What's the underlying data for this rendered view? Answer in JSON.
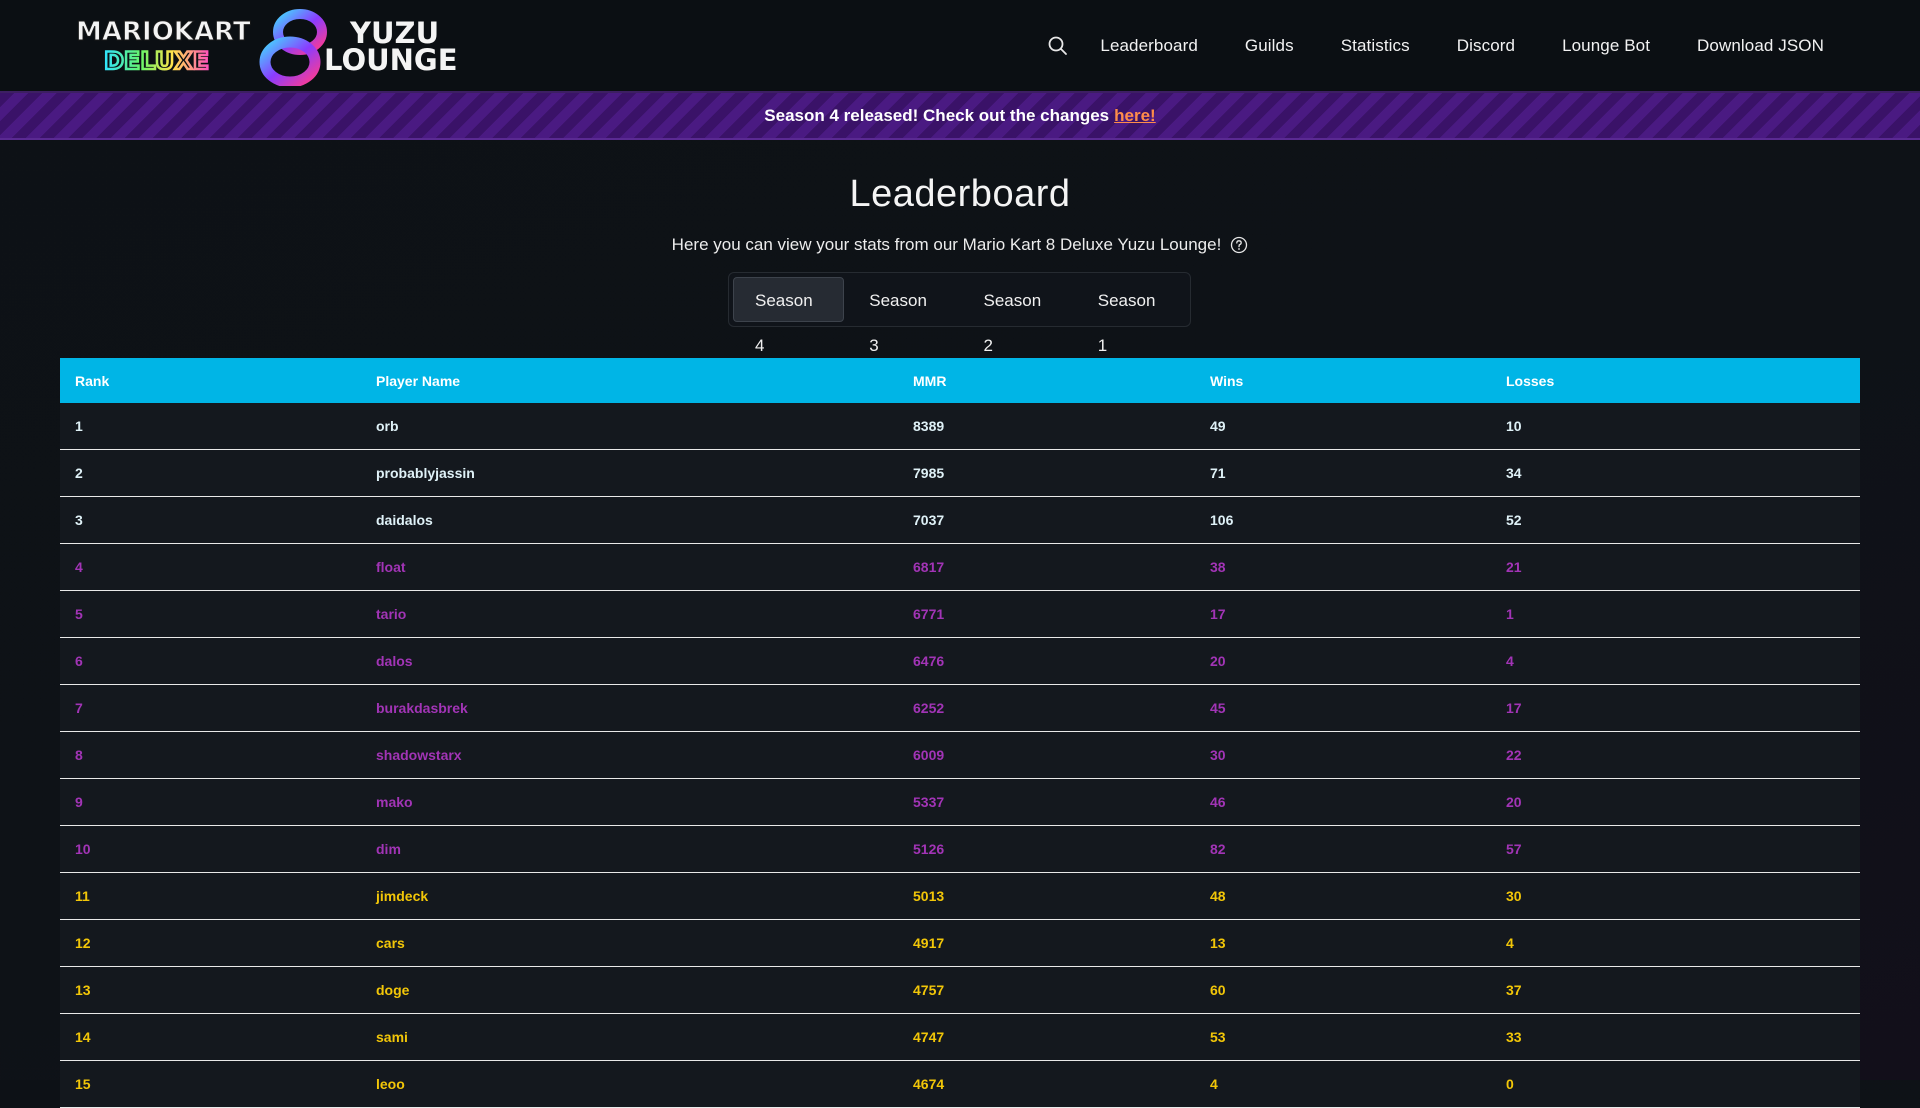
{
  "header": {
    "logo_lines": [
      "MARIOKART",
      "DELUXE",
      "8",
      "YUZU",
      "LOUNGE"
    ],
    "nav": [
      "Leaderboard",
      "Guilds",
      "Statistics",
      "Discord",
      "Lounge Bot",
      "Download JSON"
    ]
  },
  "banner": {
    "text": "Season 4 released! Check out the changes",
    "link": "here!"
  },
  "page": {
    "title": "Leaderboard",
    "subtitle": "Here you can view your stats from our Mario Kart 8 Deluxe Yuzu Lounge!"
  },
  "seasons": {
    "tabs": [
      "Season 4",
      "Season 3",
      "Season 2",
      "Season 1"
    ],
    "selected": "Season 4"
  },
  "table": {
    "columns": [
      "Rank",
      "Player Name",
      "MMR",
      "Wins",
      "Losses"
    ],
    "rows": [
      {
        "rank": "1",
        "name": "orb",
        "mmr": "8389",
        "wins": "49",
        "losses": "10",
        "tier": "diamond"
      },
      {
        "rank": "2",
        "name": "probablyjassin",
        "mmr": "7985",
        "wins": "71",
        "losses": "34",
        "tier": "diamond"
      },
      {
        "rank": "3",
        "name": "daidalos",
        "mmr": "7037",
        "wins": "106",
        "losses": "52",
        "tier": "diamond"
      },
      {
        "rank": "4",
        "name": "float",
        "mmr": "6817",
        "wins": "38",
        "losses": "21",
        "tier": "master"
      },
      {
        "rank": "5",
        "name": "tario",
        "mmr": "6771",
        "wins": "17",
        "losses": "1",
        "tier": "master"
      },
      {
        "rank": "6",
        "name": "dalos",
        "mmr": "6476",
        "wins": "20",
        "losses": "4",
        "tier": "master"
      },
      {
        "rank": "7",
        "name": "burakdasbrek",
        "mmr": "6252",
        "wins": "45",
        "losses": "17",
        "tier": "master"
      },
      {
        "rank": "8",
        "name": "shadowstarx",
        "mmr": "6009",
        "wins": "30",
        "losses": "22",
        "tier": "master"
      },
      {
        "rank": "9",
        "name": "mako",
        "mmr": "5337",
        "wins": "46",
        "losses": "20",
        "tier": "master"
      },
      {
        "rank": "10",
        "name": "dim",
        "mmr": "5126",
        "wins": "82",
        "losses": "57",
        "tier": "master"
      },
      {
        "rank": "11",
        "name": "jimdeck",
        "mmr": "5013",
        "wins": "48",
        "losses": "30",
        "tier": "gold"
      },
      {
        "rank": "12",
        "name": "cars",
        "mmr": "4917",
        "wins": "13",
        "losses": "4",
        "tier": "gold"
      },
      {
        "rank": "13",
        "name": "doge",
        "mmr": "4757",
        "wins": "60",
        "losses": "37",
        "tier": "gold"
      },
      {
        "rank": "14",
        "name": "sami",
        "mmr": "4747",
        "wins": "53",
        "losses": "33",
        "tier": "gold"
      },
      {
        "rank": "15",
        "name": "leoo",
        "mmr": "4674",
        "wins": "4",
        "losses": "0",
        "tier": "gold"
      }
    ]
  },
  "colors": {
    "header_bg": "#0b0f13",
    "banner_purple": "#3a1268",
    "banner_link": "#ff8c4a",
    "table_header": "#00b5e6",
    "tier_diamond": "#dff1f7",
    "tier_master": "#a234b6",
    "tier_gold": "#f2c608"
  },
  "icons": [
    "search-icon",
    "help-circle-icon"
  ]
}
